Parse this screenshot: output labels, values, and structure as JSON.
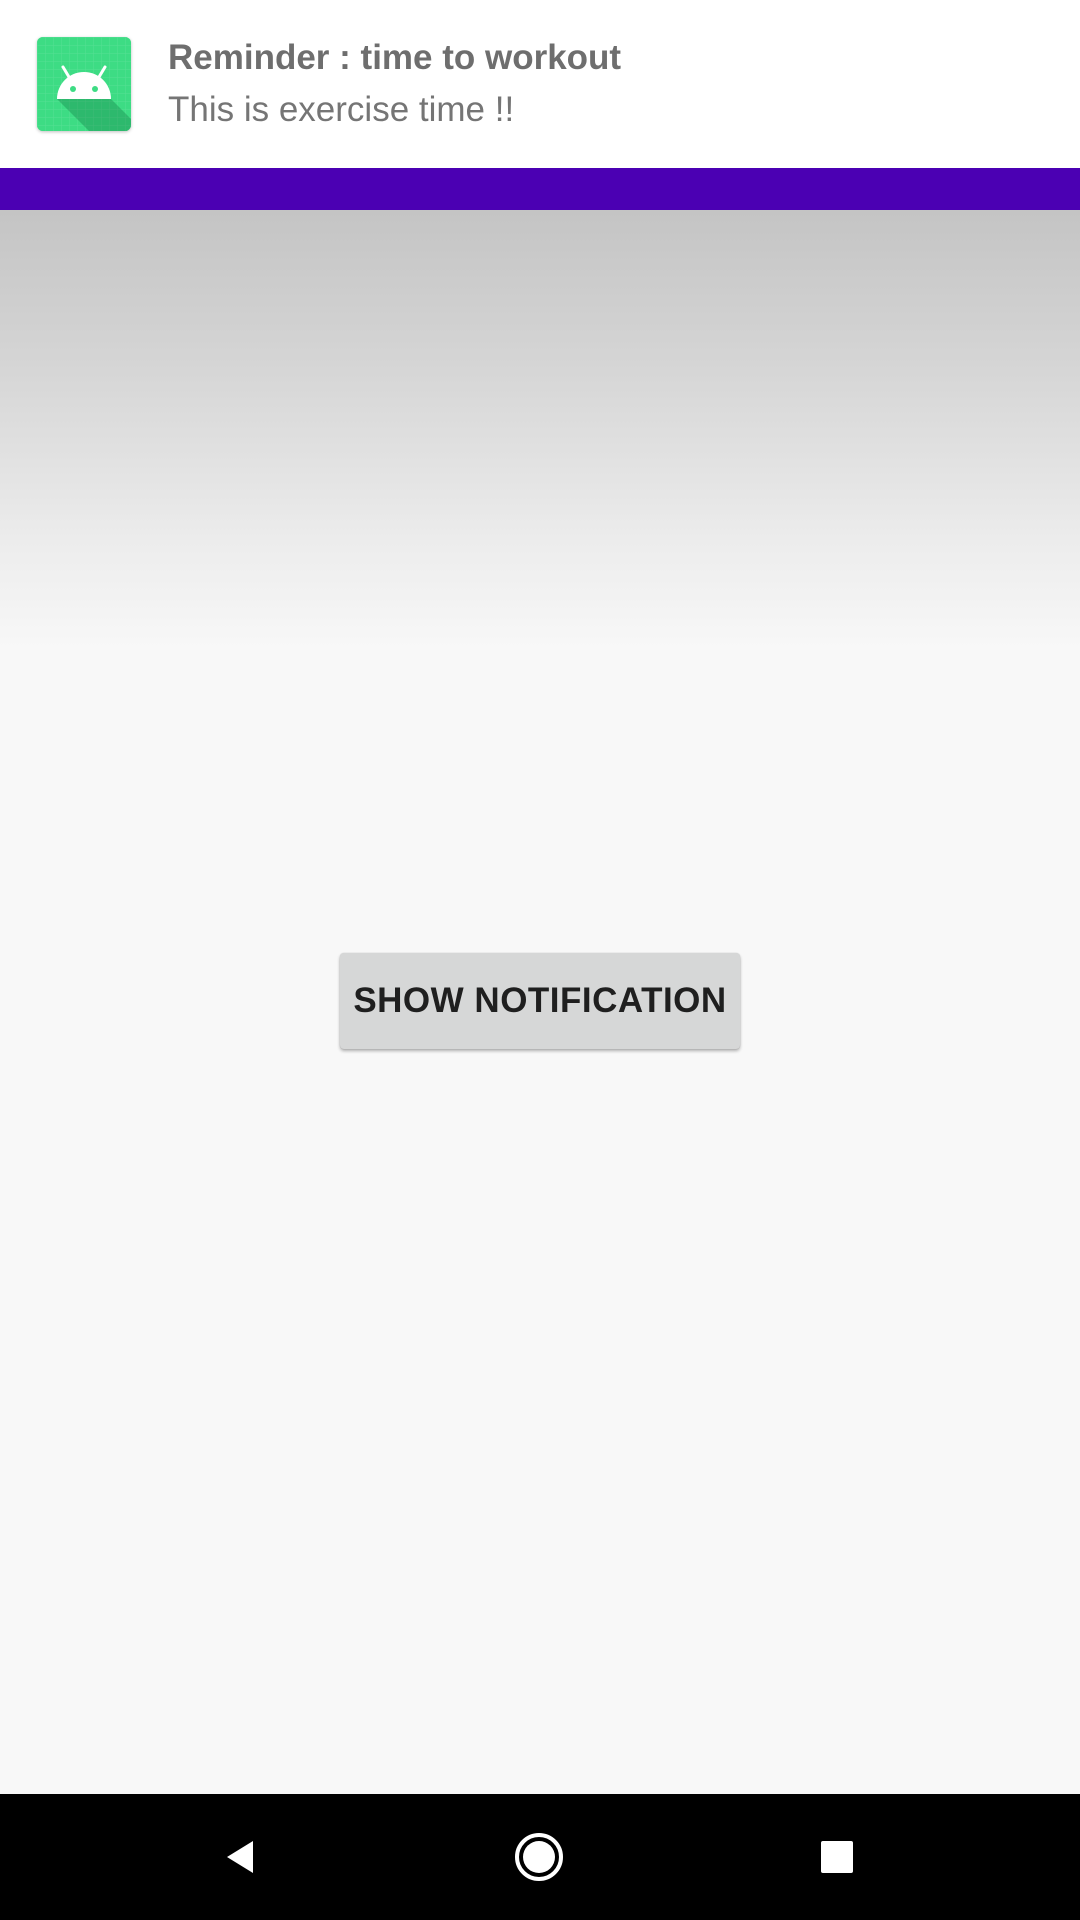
{
  "notification": {
    "title": "Reminder : time to workout",
    "text": "This is exercise time !!",
    "icon": "android-app-icon",
    "icon_color": "#3ddc84"
  },
  "app_bar": {
    "color": "#4b00b3"
  },
  "main": {
    "show_notification_label": "SHOW NOTIFICATION"
  },
  "nav_bar": {
    "back_icon": "back-triangle-icon",
    "home_icon": "home-circle-icon",
    "recents_icon": "recents-square-icon"
  }
}
